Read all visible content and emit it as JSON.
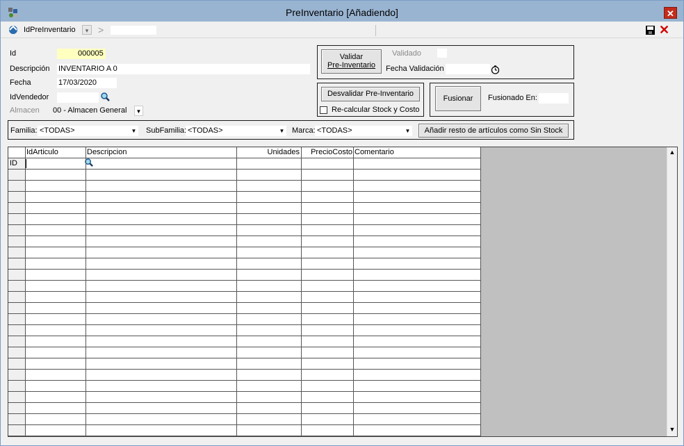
{
  "window": {
    "title": "PreInventario [Añadiendo]",
    "close_label": "✕"
  },
  "toolbar": {
    "combo_label": "IdPreInventario",
    "combo_arrow": "▾",
    "next_label": ">",
    "cancel_label": "✕"
  },
  "form": {
    "id_label": "Id",
    "id_value": "000005",
    "descripcion_label": "Descripción",
    "descripcion_value": "INVENTARIO A 0",
    "fecha_label": "Fecha",
    "fecha_value": "17/03/2020",
    "idvendedor_label": "IdVendedor",
    "almacen_label": "Almacen",
    "almacen_value": "00 - Almacen General"
  },
  "validation": {
    "validar_label_line1": "Validar",
    "validar_label_line2": "Pre-Inventario",
    "validado_label": "Validado",
    "fecha_validacion_label": "Fecha Validación",
    "desvalidar_label": "Desvalidar Pre-Inventario",
    "recalcular_label": "Re-calcular Stock y Costo",
    "recalcular_checked": false,
    "fusionar_label": "Fusionar",
    "fusionado_en_label": "Fusionado En:"
  },
  "filters": {
    "familia_label": "Familia:",
    "familia_value": "<TODAS>",
    "subfamilia_label": "SubFamilia:",
    "subfamilia_value": "<TODAS>",
    "marca_label": "Marca:",
    "marca_value": "<TODAS>",
    "add_rest_label": "Añadir resto de artículos como Sin Stock"
  },
  "grid": {
    "columns": [
      "IdArticulo",
      "Descripcion",
      "Unidades",
      "PrecioCosto",
      "Comentario"
    ],
    "first_row_header": "ID",
    "empty_rows": 24
  },
  "icons": {
    "app": "app-icon",
    "toolbar": "idpreinventario-icon",
    "search": "search-icon",
    "clock": "clock-icon",
    "save": "save-icon",
    "cancel": "cancel-icon"
  },
  "colors": {
    "titlebar": "#99b4d1",
    "close": "#c42b1c",
    "id_highlight": "#ffffc0",
    "grid_empty": "#c0c0c0"
  }
}
